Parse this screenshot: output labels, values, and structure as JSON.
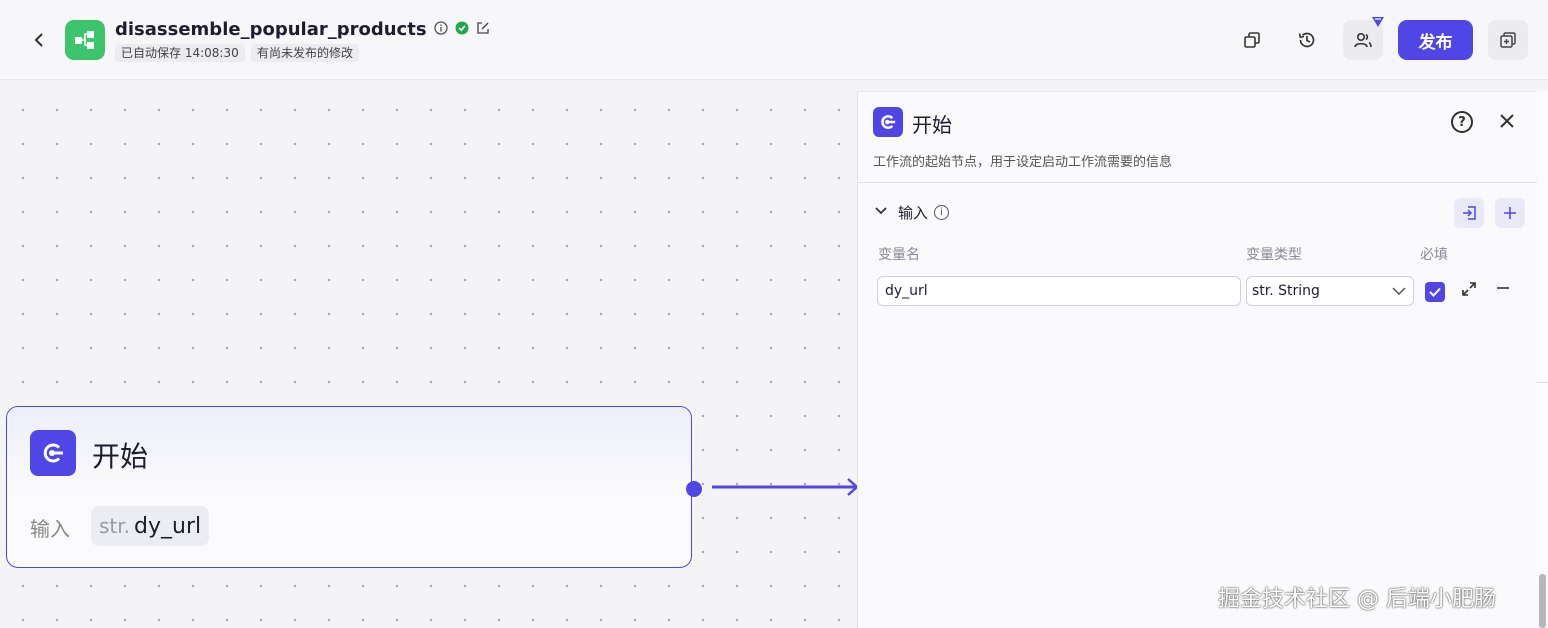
{
  "header": {
    "back_icon": "chevron-left-icon",
    "app_icon": "workflow-icon",
    "title": "disassemble_popular_products",
    "autosave_tag": "已自动保存 14:08:30",
    "unpublished_tag": "有尚未发布的修改",
    "publish_label": "发布"
  },
  "canvas": {
    "node": {
      "title": "开始",
      "input_label": "输入",
      "var_type": "str.",
      "var_name": "dy_url"
    }
  },
  "panel": {
    "title": "开始",
    "description": "工作流的起始节点，用于设定启动工作流需要的信息",
    "section_title": "输入",
    "col_name": "变量名",
    "col_type": "变量类型",
    "col_required": "必填",
    "row": {
      "name": "dy_url",
      "type": "str. String",
      "required": true
    }
  },
  "watermark": "掘金技术社区 @ 后端小肥肠",
  "colors": {
    "accent": "#4f46e5",
    "app_logo": "#3ec46d",
    "status_ok": "#22a84a"
  }
}
